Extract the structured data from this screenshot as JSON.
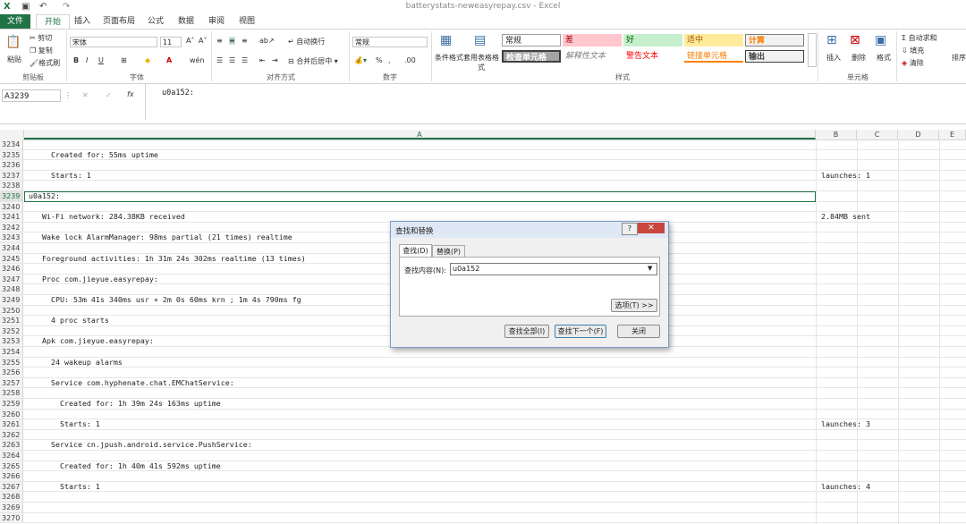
{
  "window": {
    "title": "batterystats-neweasyrepay.csv - Excel"
  },
  "tabs": [
    "文件",
    "开始",
    "插入",
    "页面布局",
    "公式",
    "数据",
    "审阅",
    "视图"
  ],
  "ribbon": {
    "clipboard": {
      "paste": "粘贴",
      "cut": "剪切",
      "copy": "复制",
      "format_painter": "格式刷",
      "label": "剪贴板"
    },
    "font": {
      "name": "宋体",
      "size": "11",
      "label": "字体",
      "bold": "B",
      "italic": "I",
      "underline": "U"
    },
    "alignment": {
      "wrap": "自动换行",
      "merge": "合并后居中",
      "label": "对齐方式"
    },
    "number": {
      "format": "常规",
      "percent": "%",
      "comma": ",",
      "label": "数字"
    },
    "styles": {
      "conditional": "条件格式",
      "as_table": "套用表格格式",
      "cells": [
        "常规",
        "差",
        "好",
        "适中",
        "计算",
        "检查单元格",
        "解释性文本",
        "警告文本",
        "链接单元格",
        "输出"
      ],
      "label": "样式"
    },
    "cells": {
      "insert": "插入",
      "delete": "删除",
      "format": "格式",
      "label": "单元格"
    },
    "editing": {
      "autosum": "自动求和",
      "fill": "填充",
      "clear": "清除",
      "sort": "排序"
    }
  },
  "formula_bar": {
    "name_box": "A3239",
    "fx": "fx",
    "content": "u0a152:"
  },
  "columns": [
    "A",
    "B",
    "C",
    "D",
    "E"
  ],
  "rows": [
    {
      "n": "3234",
      "a": "",
      "b": ""
    },
    {
      "n": "3235",
      "a": "      Created for: 55ms uptime",
      "b": ""
    },
    {
      "n": "3236",
      "a": "",
      "b": ""
    },
    {
      "n": "3237",
      "a": "      Starts: 1",
      "b": "launches: 1"
    },
    {
      "n": "3238",
      "a": "",
      "b": ""
    },
    {
      "n": "3239",
      "a": " u0a152:",
      "b": ""
    },
    {
      "n": "3240",
      "a": "",
      "b": ""
    },
    {
      "n": "3241",
      "a": "    Wi-Fi network: 284.38KB received",
      "b": "2.84MB sent"
    },
    {
      "n": "3242",
      "a": "",
      "b": ""
    },
    {
      "n": "3243",
      "a": "    Wake lock AlarmManager: 98ms partial (21 times) realtime",
      "b": ""
    },
    {
      "n": "3244",
      "a": "",
      "b": ""
    },
    {
      "n": "3245",
      "a": "    Foreground activities: 1h 31m 24s 302ms realtime (13 times)",
      "b": ""
    },
    {
      "n": "3246",
      "a": "",
      "b": ""
    },
    {
      "n": "3247",
      "a": "    Proc com.jieyue.easyrepay:",
      "b": ""
    },
    {
      "n": "3248",
      "a": "",
      "b": ""
    },
    {
      "n": "3249",
      "a": "      CPU: 53m 41s 340ms usr + 2m 0s 60ms krn ; 1m 4s 790ms fg",
      "b": ""
    },
    {
      "n": "3250",
      "a": "",
      "b": ""
    },
    {
      "n": "3251",
      "a": "      4 proc starts",
      "b": ""
    },
    {
      "n": "3252",
      "a": "",
      "b": ""
    },
    {
      "n": "3253",
      "a": "    Apk com.jieyue.easyrepay:",
      "b": ""
    },
    {
      "n": "3254",
      "a": "",
      "b": ""
    },
    {
      "n": "3255",
      "a": "      24 wakeup alarms",
      "b": ""
    },
    {
      "n": "3256",
      "a": "",
      "b": ""
    },
    {
      "n": "3257",
      "a": "      Service com.hyphenate.chat.EMChatService:",
      "b": ""
    },
    {
      "n": "3258",
      "a": "",
      "b": ""
    },
    {
      "n": "3259",
      "a": "        Created for: 1h 39m 24s 163ms uptime",
      "b": ""
    },
    {
      "n": "3260",
      "a": "",
      "b": ""
    },
    {
      "n": "3261",
      "a": "        Starts: 1",
      "b": "launches: 3"
    },
    {
      "n": "3262",
      "a": "",
      "b": ""
    },
    {
      "n": "3263",
      "a": "      Service cn.jpush.android.service.PushService:",
      "b": ""
    },
    {
      "n": "3264",
      "a": "",
      "b": ""
    },
    {
      "n": "3265",
      "a": "        Created for: 1h 40m 41s 592ms uptime",
      "b": ""
    },
    {
      "n": "3266",
      "a": "",
      "b": ""
    },
    {
      "n": "3267",
      "a": "        Starts: 1",
      "b": "launches: 4"
    },
    {
      "n": "3268",
      "a": "",
      "b": ""
    },
    {
      "n": "3269",
      "a": "",
      "b": ""
    },
    {
      "n": "3270",
      "a": "",
      "b": ""
    }
  ],
  "dialog": {
    "title": "查找和替换",
    "tab_find": "查找(D)",
    "tab_replace": "替换(P)",
    "find_label": "查找内容(N):",
    "find_value": "u0a152",
    "options": "选项(T) >>",
    "find_all": "查找全部(I)",
    "find_next": "查找下一个(F)",
    "close": "关闭"
  },
  "colors": {
    "accent": "#217346"
  }
}
